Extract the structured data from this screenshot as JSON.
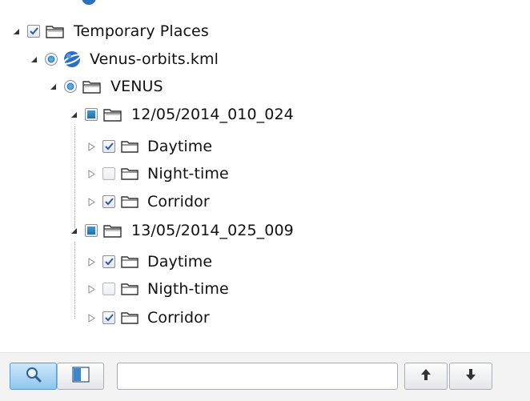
{
  "tree": {
    "root": {
      "label": "Temporary Places",
      "checked": true,
      "expanded": true
    },
    "file": {
      "label": "Venus-orbits.kml",
      "selected": true,
      "expanded": true
    },
    "planet": {
      "label": "VENUS",
      "selected": true,
      "expanded": true
    },
    "dates": [
      {
        "label": "12/05/2014_010_024",
        "state": "partial",
        "children": [
          {
            "label": "Daytime",
            "checked": true
          },
          {
            "label": "Night-time",
            "checked": false
          },
          {
            "label": "Corridor",
            "checked": true
          }
        ]
      },
      {
        "label": "13/05/2014_025_009",
        "state": "partial",
        "children": [
          {
            "label": "Daytime",
            "checked": true
          },
          {
            "label": "Nigth-time",
            "checked": false
          },
          {
            "label": "Corridor",
            "checked": true
          }
        ]
      }
    ]
  },
  "toolbar": {
    "search_button": {
      "icon": "magnifier-icon",
      "active": true
    },
    "panel_button": {
      "icon": "panel-icon"
    },
    "search_value": "",
    "search_placeholder": "",
    "up_button": {
      "icon": "arrow-up-icon"
    },
    "down_button": {
      "icon": "arrow-down-icon"
    }
  },
  "colors": {
    "accent": "#2a7ec4",
    "partial_fill": "#1e6fab",
    "guide": "#a9a9a9"
  }
}
